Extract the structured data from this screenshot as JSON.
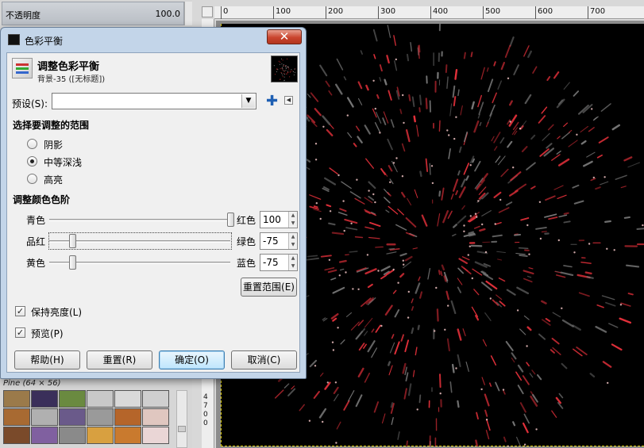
{
  "background": {
    "opacity_label": "不透明度",
    "opacity_value": "100.0",
    "pattern_label": "Pine (64 × 56)",
    "ruler_top": [
      "0",
      "100",
      "200",
      "300",
      "400",
      "500",
      "600",
      "700"
    ],
    "ruler_side": [
      "4",
      "7",
      "0",
      "0"
    ]
  },
  "dialog": {
    "window_title": "色彩平衡",
    "close_glyph": "✕",
    "header_title": "调整色彩平衡",
    "header_subtitle": "背景-35 ([无标题])",
    "preset_label": "预设(S):",
    "preset_value": "",
    "range_section": "选择要调整的范围",
    "ranges": [
      {
        "label": "阴影",
        "selected": false
      },
      {
        "label": "中等深浅",
        "selected": true
      },
      {
        "label": "高亮",
        "selected": false
      }
    ],
    "levels_section": "调整颜色色阶",
    "sliders": [
      {
        "left": "青色",
        "right": "红色",
        "value": "100",
        "level": 100
      },
      {
        "left": "品红",
        "right": "绿色",
        "value": "-75",
        "level": -75
      },
      {
        "left": "黄色",
        "right": "蓝色",
        "value": "-75",
        "level": -75
      }
    ],
    "reset_range_button": "重置范围(E)",
    "preserve_luminosity": {
      "label": "保持亮度(L)",
      "checked": true
    },
    "preview": {
      "label": "预览(P)",
      "checked": true
    },
    "buttons": {
      "help": "帮助(H)",
      "reset": "重置(R)",
      "ok": "确定(O)",
      "cancel": "取消(C)"
    },
    "check_glyph": "✓",
    "arrow_down": "▼",
    "spin_up": "▲",
    "spin_down": "▼",
    "add_glyph": "✚",
    "menu_glyph": "◀"
  }
}
